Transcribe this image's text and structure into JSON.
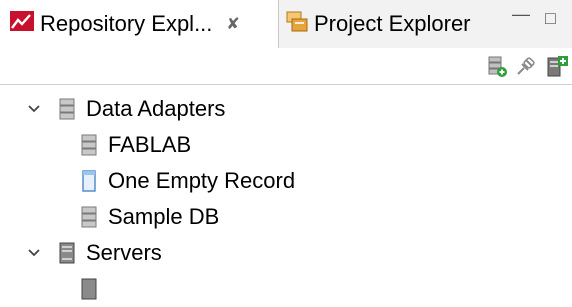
{
  "tabs": [
    {
      "label": "Repository Expl...",
      "icon": "repository-icon",
      "close": "✘",
      "active": true
    },
    {
      "label": "Project Explorer",
      "icon": "project-folder-icon",
      "active": false
    }
  ],
  "window_controls": {
    "minimize": "—",
    "maximize": "□"
  },
  "toolbar": {
    "buttons": [
      {
        "name": "add-data-adapter-icon"
      },
      {
        "name": "link-icon"
      },
      {
        "name": "add-server-icon"
      }
    ]
  },
  "tree": {
    "nodes": [
      {
        "label": "Data Adapters",
        "level": 0,
        "expanded": true,
        "icon": "database-icon"
      },
      {
        "label": "FABLAB",
        "level": 1,
        "icon": "database-icon"
      },
      {
        "label": "One Empty Record",
        "level": 1,
        "icon": "empty-record-icon"
      },
      {
        "label": "Sample DB",
        "level": 1,
        "icon": "database-icon"
      },
      {
        "label": "Servers",
        "level": 0,
        "expanded": true,
        "icon": "server-icon"
      }
    ]
  },
  "colors": {
    "accent_red": "#d9001b",
    "project_orange": "#e8a33c",
    "server_green": "#2e9e3a"
  }
}
